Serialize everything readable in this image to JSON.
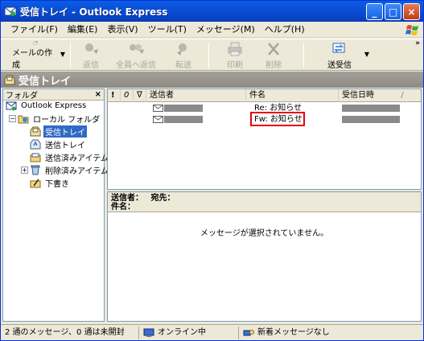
{
  "window": {
    "title": "受信トレイ - Outlook Express",
    "controls": [
      "_",
      "□",
      "×"
    ]
  },
  "menu": [
    "ファイル(F)",
    "編集(E)",
    "表示(V)",
    "ツール(T)",
    "メッセージ(M)",
    "ヘルプ(H)"
  ],
  "toolbar": {
    "compose": "メールの作成",
    "reply": "返信",
    "reply_all": "全員へ返信",
    "forward": "転送",
    "print": "印刷",
    "delete": "削除",
    "send_receive": "送受信",
    "more": "»"
  },
  "folder_title": "受信トレイ",
  "folder_pane": {
    "header": "フォルダ",
    "close": "×",
    "items": [
      "Outlook Express",
      "ローカル フォルダ",
      "受信トレイ",
      "送信トレイ",
      "送信済みアイテム",
      "削除済みアイテム",
      "下書き"
    ]
  },
  "message_list": {
    "columns": {
      "flag_priority": "!",
      "attachment": "0",
      "flag": "ᐁ",
      "from": "送信者",
      "subject": "件名",
      "received": "受信日時",
      "sort_mark": "/"
    },
    "rows": [
      {
        "subject": "Re: お知らせ"
      },
      {
        "subject": "Fw: お知らせ"
      }
    ]
  },
  "preview": {
    "from_label": "送信者：",
    "to_label": "宛先：",
    "subject_label": "件名：",
    "empty_message": "メッセージが選択されていません。"
  },
  "status": {
    "count": "2 通のメッセージ、0 通は未開封",
    "online": "オンライン中",
    "new_mail": "新着メッセージなし"
  },
  "colors": {
    "selection": "#316ac5",
    "highlight_border": "#e60012",
    "titlebar": "#0a50d8"
  }
}
